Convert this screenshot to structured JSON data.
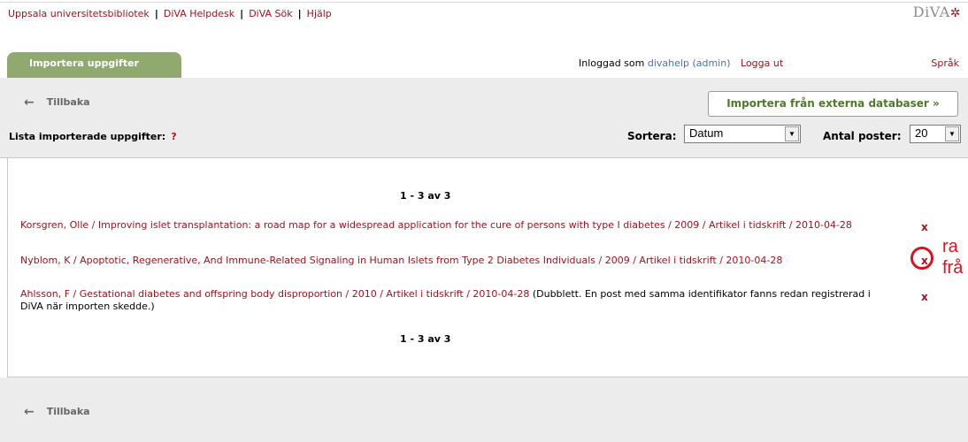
{
  "top_links": [
    "Uppsala universitetsbibliotek",
    "DiVA Helpdesk",
    "DiVA Sök",
    "Hjälp"
  ],
  "logo": {
    "text": "DiVA",
    "star": "✲"
  },
  "tab": {
    "label": "Importera uppgifter"
  },
  "login": {
    "prefix": "Inloggad som",
    "user": "divahelp (admin)",
    "logout": "Logga ut"
  },
  "language": "Språk",
  "toolbar": {
    "back": "Tillbaka",
    "import_button": "Importera från externa databaser »",
    "list_label": "Lista importerade uppgifter:",
    "help": "?",
    "sort_label": "Sortera:",
    "sort_value": "Datum",
    "count_label": "Antal poster:",
    "count_value": "20"
  },
  "pager": "1 - 3 av 3",
  "records": [
    {
      "link": "Korsgren, Olle / Improving islet transplantation: a road map for a widespread application for the cure of persons with type I diabetes / 2009 / Artikel i tidskrift / 2010-04-28",
      "note": "",
      "delete": "x"
    },
    {
      "link": "Nyblom, K / Apoptotic, Regenerative, And Immune-Related Signaling in Human Islets from Type 2 Diabetes Individuals / 2009 / Artikel i tidskrift / 2010-04-28",
      "note": "",
      "delete": "x"
    },
    {
      "link": "Ahlsson, F / Gestational diabetes and offspring body disproportion / 2010 / Artikel i tidskrift / 2010-04-28",
      "note": " (Dubblett. En post med samma identifikator fanns redan registrerad i DiVA när importen skedde.)",
      "delete": "x"
    }
  ],
  "annotation": {
    "line1": "ra",
    "line2": "frå"
  },
  "colors": {
    "accent_red": "#a0121e",
    "tab_green": "#8fa96e",
    "button_green": "#4d7a2a",
    "panel_gray": "#ececec",
    "annotation_red": "#d8121e"
  }
}
